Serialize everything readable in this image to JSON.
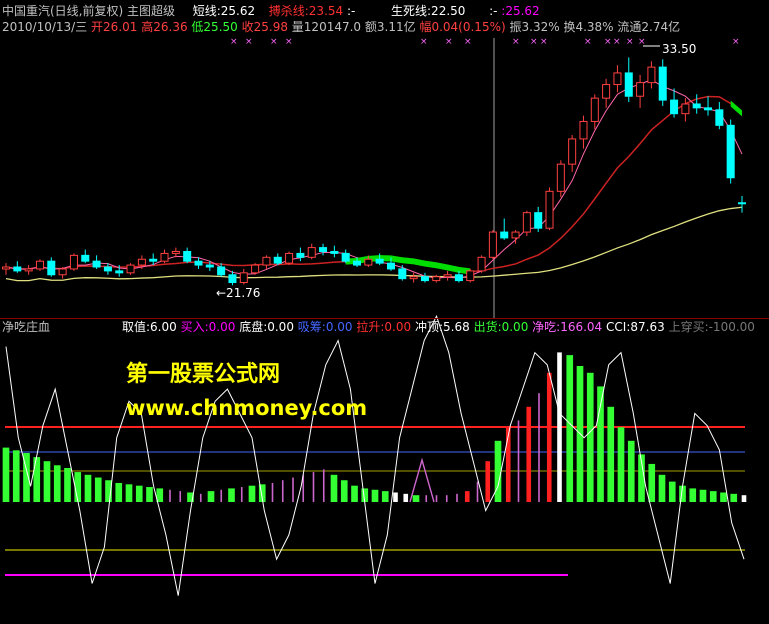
{
  "header": {
    "title": "中国重汽(日线,前复权)",
    "indicator": "主图超级",
    "short_line": "短线:25.62",
    "bear_line": "搏杀线:23.54",
    "bear_line_suffix": ":-",
    "life_line": "生死线:22.50",
    "life_line_suffix": ":-",
    "last_value": ":25.62",
    "date": "2010/10/13/三",
    "open": "开26.01",
    "high": "高26.36",
    "low": "低25.50",
    "close": "收25.98",
    "volume": "量120147.0",
    "amount": "额3.11亿",
    "change": "幅0.04(0.15%)",
    "amplitude": "振3.32%",
    "turnover": "换4.38%",
    "float": "流通2.74亿"
  },
  "lower_header": {
    "name": "净吃庄血",
    "take": "取值:6.00",
    "buy": "买入:0.00",
    "bottom": "底盘:0.00",
    "absorb": "吸筹:0.00",
    "lift": "拉升:0.00",
    "top": "冲顶:5.68",
    "ship": "出货:0.00",
    "net_eat": "净吃:166.04",
    "cci": "CCI:87.63",
    "cross_up": "上穿买:-100.00"
  },
  "annotations": {
    "high_label": "33.50",
    "low_label": "←21.76"
  },
  "watermark": {
    "line1": "第一股票公式网",
    "line2": "www.chnmoney.com"
  },
  "colors": {
    "up": "#ff4040",
    "down": "#00ffff",
    "ma_short": "#ff66aa",
    "ma_mid": "#cc2222",
    "ma_long": "#e0e080",
    "ribbon": "#00dd00",
    "bar_green": "#33ff33",
    "bar_magenta": "#cc66cc",
    "bar_red": "#ff2020",
    "bar_white": "#ffffff",
    "cci_line": "#ffffff",
    "hline_red": "#ff2020",
    "hline_blue": "#4466ff",
    "hline_yellow": "#a0a000",
    "hline_magenta": "#ff00ff"
  },
  "chart_data": [
    {
      "type": "candlestick",
      "title": "中国重汽(日线,前复权)",
      "ylim": [
        21,
        34.5
      ],
      "candles": [
        [
          22.6,
          22.9,
          22.3,
          22.7
        ],
        [
          22.7,
          23.0,
          22.4,
          22.5
        ],
        [
          22.5,
          22.8,
          22.3,
          22.6
        ],
        [
          22.6,
          23.1,
          22.5,
          23.0
        ],
        [
          23.0,
          23.2,
          22.2,
          22.3
        ],
        [
          22.3,
          22.7,
          22.1,
          22.6
        ],
        [
          22.6,
          23.4,
          22.5,
          23.3
        ],
        [
          23.3,
          23.6,
          22.9,
          23.0
        ],
        [
          23.0,
          23.3,
          22.6,
          22.7
        ],
        [
          22.7,
          22.9,
          22.3,
          22.5
        ],
        [
          22.5,
          22.8,
          22.2,
          22.4
        ],
        [
          22.4,
          22.9,
          22.3,
          22.8
        ],
        [
          22.8,
          23.3,
          22.6,
          23.1
        ],
        [
          23.1,
          23.4,
          22.8,
          23.0
        ],
        [
          23.0,
          23.6,
          22.9,
          23.4
        ],
        [
          23.4,
          23.7,
          23.2,
          23.5
        ],
        [
          23.5,
          23.7,
          22.9,
          23.0
        ],
        [
          23.0,
          23.2,
          22.6,
          22.8
        ],
        [
          22.8,
          23.0,
          22.5,
          22.7
        ],
        [
          22.7,
          22.9,
          22.2,
          22.3
        ],
        [
          22.3,
          22.5,
          21.76,
          21.9
        ],
        [
          21.9,
          22.6,
          21.8,
          22.4
        ],
        [
          22.4,
          22.9,
          22.3,
          22.8
        ],
        [
          22.8,
          23.3,
          22.6,
          23.2
        ],
        [
          23.2,
          23.4,
          22.8,
          22.9
        ],
        [
          22.9,
          23.5,
          22.8,
          23.4
        ],
        [
          23.4,
          23.7,
          23.0,
          23.2
        ],
        [
          23.2,
          23.9,
          23.1,
          23.7
        ],
        [
          23.7,
          23.9,
          23.3,
          23.5
        ],
        [
          23.5,
          23.8,
          23.2,
          23.4
        ],
        [
          23.4,
          23.6,
          22.9,
          23.0
        ],
        [
          23.0,
          23.2,
          22.7,
          22.8
        ],
        [
          22.8,
          23.3,
          22.7,
          23.1
        ],
        [
          23.1,
          23.4,
          22.8,
          22.9
        ],
        [
          22.9,
          23.2,
          22.5,
          22.6
        ],
        [
          22.6,
          22.8,
          22.0,
          22.1
        ],
        [
          22.1,
          22.4,
          21.9,
          22.2
        ],
        [
          22.2,
          22.4,
          21.9,
          22.0
        ],
        [
          22.0,
          22.3,
          21.9,
          22.2
        ],
        [
          22.2,
          22.5,
          22.0,
          22.3
        ],
        [
          22.3,
          22.5,
          21.9,
          22.0
        ],
        [
          22.0,
          22.6,
          21.9,
          22.5
        ],
        [
          22.5,
          23.3,
          22.4,
          23.2
        ],
        [
          23.2,
          24.6,
          23.1,
          24.5
        ],
        [
          24.5,
          25.2,
          24.1,
          24.2
        ],
        [
          24.2,
          24.6,
          23.9,
          24.5
        ],
        [
          24.5,
          25.6,
          24.3,
          25.5
        ],
        [
          25.5,
          25.8,
          24.5,
          24.7
        ],
        [
          24.7,
          26.8,
          24.6,
          26.6
        ],
        [
          26.6,
          28.2,
          26.3,
          28.0
        ],
        [
          28.0,
          29.5,
          27.6,
          29.3
        ],
        [
          29.3,
          30.5,
          28.8,
          30.2
        ],
        [
          30.2,
          31.6,
          29.8,
          31.4
        ],
        [
          31.4,
          32.4,
          30.9,
          32.1
        ],
        [
          32.1,
          33.1,
          31.7,
          32.7
        ],
        [
          32.7,
          33.5,
          31.2,
          31.5
        ],
        [
          31.5,
          32.6,
          30.9,
          32.2
        ],
        [
          32.2,
          33.3,
          31.9,
          33.0
        ],
        [
          33.0,
          33.4,
          31.0,
          31.3
        ],
        [
          31.3,
          31.9,
          30.4,
          30.6
        ],
        [
          30.6,
          31.4,
          30.2,
          31.1
        ],
        [
          31.1,
          31.6,
          30.6,
          30.9
        ],
        [
          30.9,
          31.5,
          30.5,
          30.8
        ],
        [
          30.8,
          31.2,
          29.8,
          30.0
        ],
        [
          30.0,
          30.3,
          27.0,
          27.3
        ],
        [
          26.01,
          26.36,
          25.5,
          25.98
        ]
      ]
    },
    {
      "type": "bar",
      "title": "净吃庄血",
      "ylim": [
        -80,
        120
      ],
      "series": [
        {
          "name": "bars",
          "values": [
            40,
            38,
            36,
            33,
            30,
            27,
            25,
            22,
            20,
            18,
            16,
            14,
            13,
            12,
            11,
            10,
            9,
            8,
            7,
            6,
            8,
            9,
            10,
            11,
            12,
            13,
            14,
            16,
            18,
            20,
            22,
            24,
            20,
            16,
            12,
            10,
            9,
            8,
            7,
            6,
            5,
            5,
            5,
            5,
            6,
            8,
            15,
            30,
            45,
            55,
            60,
            70,
            80,
            95,
            110,
            108,
            100,
            95,
            85,
            70,
            55,
            45,
            35,
            28,
            20,
            15,
            12,
            10,
            9,
            8,
            7,
            6,
            5
          ],
          "colors": [
            "g",
            "g",
            "g",
            "g",
            "g",
            "g",
            "g",
            "g",
            "g",
            "g",
            "g",
            "g",
            "g",
            "g",
            "g",
            "g",
            "m",
            "m",
            "g",
            "m",
            "g",
            "m",
            "g",
            "m",
            "g",
            "g",
            "m",
            "m",
            "m",
            "m",
            "m",
            "m",
            "g",
            "g",
            "g",
            "g",
            "g",
            "g",
            "w",
            "w",
            "g",
            "m",
            "m",
            "m",
            "m",
            "r",
            "m",
            "r",
            "g",
            "r",
            "m",
            "r",
            "m",
            "r",
            "w",
            "g",
            "g",
            "g",
            "g",
            "g",
            "g",
            "g",
            "g",
            "g",
            "g",
            "g",
            "g",
            "g",
            "g",
            "g",
            "g",
            "g",
            "w"
          ]
        },
        {
          "name": "CCI",
          "values": [
            95,
            20,
            -20,
            30,
            60,
            10,
            -40,
            -100,
            -70,
            20,
            50,
            40,
            -20,
            -60,
            -110,
            -40,
            20,
            50,
            60,
            40,
            20,
            -40,
            -80,
            -60,
            -20,
            40,
            80,
            100,
            60,
            -20,
            -100,
            -60,
            20,
            60,
            100,
            120,
            90,
            40,
            0,
            -40,
            -20,
            30,
            60,
            90,
            80,
            40,
            30,
            20,
            30,
            80,
            90,
            40,
            -20,
            -60,
            -100,
            -20,
            40,
            30,
            10,
            -50,
            -80
          ]
        }
      ],
      "reference_lines": [
        100,
        70,
        30,
        -60,
        -90
      ]
    }
  ]
}
